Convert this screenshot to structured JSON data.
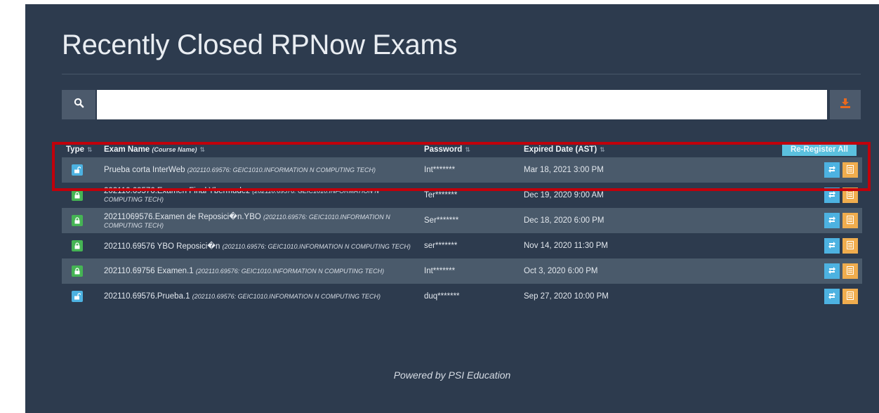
{
  "page": {
    "title": "Recently Closed RPNow Exams",
    "footer": "Powered by PSI Education"
  },
  "search": {
    "value": "",
    "placeholder": "",
    "search_icon": "search-icon",
    "download_icon": "download-icon"
  },
  "table": {
    "headers": {
      "type": "Type",
      "exam_name": "Exam Name",
      "course_name": "(Course Name)",
      "password": "Password",
      "expired": "Expired Date (AST)",
      "reregister_all": "Re-Register All"
    },
    "rows": [
      {
        "type": "open",
        "exam": "Prueba corta InterWeb",
        "course": "(202110.69576: GEIC1010.INFORMATION N COMPUTING TECH)",
        "password": "Int*******",
        "expired": "Mar 18, 2021 3:00 PM"
      },
      {
        "type": "locked",
        "exam": "202110.69576.Examen Final Ybermudez",
        "course": "(202110.69576: GEIC1010.INFORMATION N COMPUTING TECH)",
        "password": "Ter*******",
        "expired": "Dec 19, 2020 9:00 AM"
      },
      {
        "type": "locked",
        "exam": "20211069576.Examen de Reposici�n.YBO",
        "course": "(202110.69576: GEIC1010.INFORMATION N COMPUTING TECH)",
        "password": "Ser*******",
        "expired": "Dec 18, 2020 6:00 PM"
      },
      {
        "type": "locked",
        "exam": "202110.69576 YBO Reposici�n",
        "course": "(202110.69576: GEIC1010.INFORMATION N COMPUTING TECH)",
        "password": "ser*******",
        "expired": "Nov 14, 2020 11:30 PM"
      },
      {
        "type": "locked",
        "exam": "202110.69756 Examen.1",
        "course": "(202110.69576: GEIC1010.INFORMATION N COMPUTING TECH)",
        "password": "Int*******",
        "expired": "Oct 3, 2020 6:00 PM"
      },
      {
        "type": "open",
        "exam": "202110.69576.Prueba.1",
        "course": "(202110.69576: GEIC1010.INFORMATION N COMPUTING TECH)",
        "password": "duq*******",
        "expired": "Sep 27, 2020 10:00 PM"
      }
    ]
  },
  "colors": {
    "panel_bg": "#2d3b4e",
    "row_alt_bg": "#4a5a6b",
    "info_blue": "#5bc0de",
    "open_badge": "#4db2e1",
    "locked_badge": "#45b454",
    "log_orange": "#f0ad4e",
    "download_orange": "#e8691f",
    "highlight_red": "#c0000b"
  }
}
